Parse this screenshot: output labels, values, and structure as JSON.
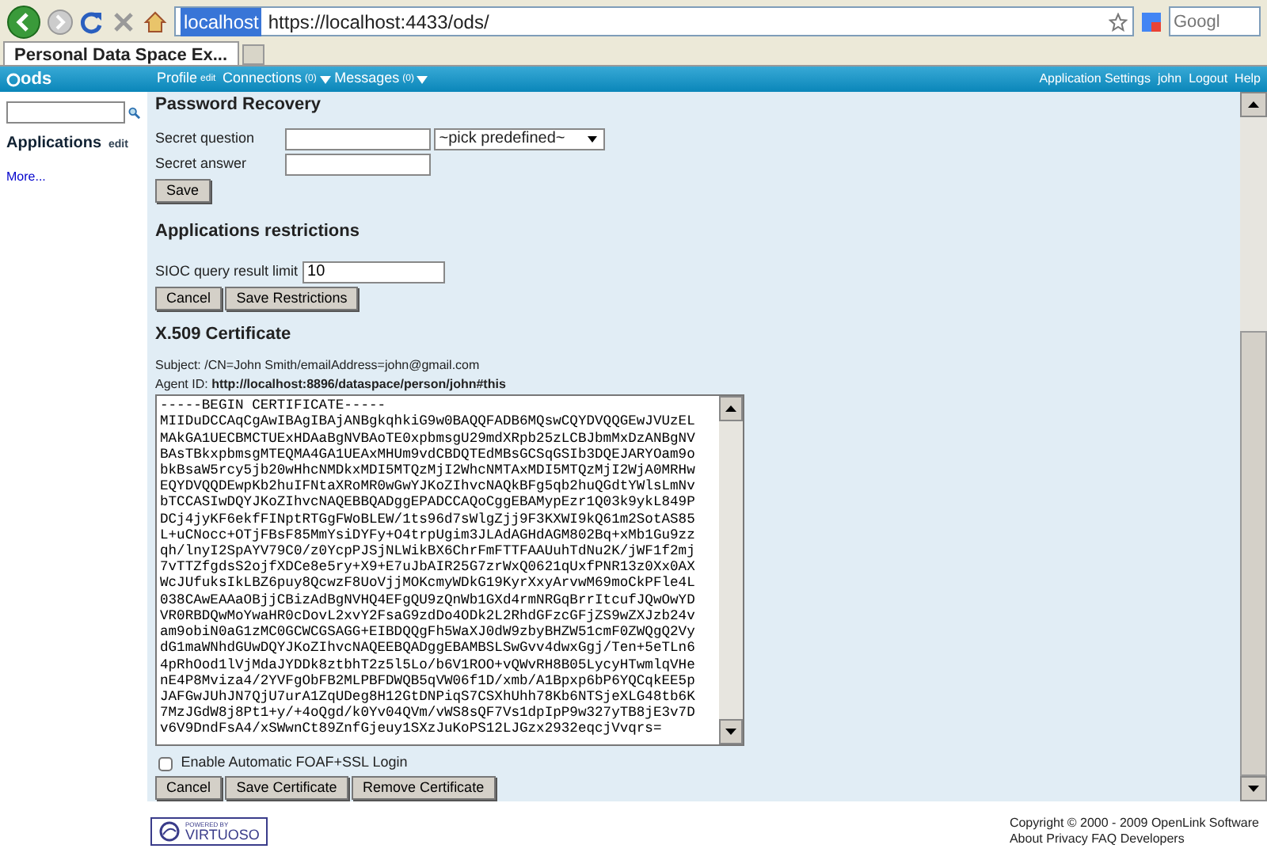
{
  "browser": {
    "address": {
      "site_badge": "localhost",
      "url": "https://localhost:4433/ods/"
    },
    "search": {
      "placeholder": "Googl"
    },
    "tabs": [
      {
        "label": "Personal Data Space Ex...",
        "selected": true
      }
    ]
  },
  "navbar": {
    "logo": "ods",
    "items": [
      {
        "label": "Profile",
        "suffix": "edit",
        "dropdown": false
      },
      {
        "label": "Connections",
        "suffix": "(0)",
        "dropdown": true
      },
      {
        "label": "Messages",
        "suffix": "(0)",
        "dropdown": true
      }
    ],
    "right_links": [
      "Application Settings",
      "john",
      "Logout",
      "Help"
    ]
  },
  "sidebar": {
    "heading": "Applications",
    "edit_link": "edit",
    "more_link": "More..."
  },
  "password_recovery": {
    "title": "Password Recovery",
    "secret_question": {
      "label": "Secret question",
      "select": "~pick predefined~"
    },
    "secret_answer": {
      "label": "Secret answer"
    },
    "buttons": [
      "Save"
    ]
  },
  "applications_restrictions": {
    "title": "Applications restrictions",
    "sioc_limit": {
      "label": "SIOC query result limit",
      "value": "10"
    },
    "buttons": [
      "Cancel",
      "Save Restrictions"
    ]
  },
  "certificate": {
    "title": "X.509 Certificate",
    "subject_label": "Subject:",
    "subject": "/CN=John Smith/emailAddress=john@gmail.com",
    "agent_label": "Agent ID:",
    "agent": "http://localhost:8896/dataspace/person/john#this",
    "text": "-----BEGIN CERTIFICATE-----\nMIIDuDCCAqCgAwIBAgIBAjANBgkqhkiG9w0BAQQFADB6MQswCQYDVQQGEwJVUzEL\nMAkGA1UECBMCTUExHDAaBgNVBAoTE0xpbmsgU29mdXRpb25zLCBJbmMxDzANBgNV\nBAsTBkxpbmsgMTEQMA4GA1UEAxMHUm9vdCBDQTEdMBsGCSqGSIb3DQEJARYOam9o\nbkBsaW5rcy5jb20wHhcNMDkxMDI5MTQzMjI2WhcNMTAxMDI5MTQzMjI2WjA0MRHw\nEQYDVQQDEwpKb2huIFNtaXRoMR0wGwYJKoZIhvcNAQkBFg5qb2huQGdtYWlsLmNv\nbTCCASIwDQYJKoZIhvcNAQEBBQADggEPADCCAQoCggEBAMypEzr1Q03k9ykL849P\nDCj4jyKF6ekfFINptRTGgFWoBLEW/1ts96d7sWlgZjj9F3KXWI9kQ61m2SotAS85\nL+uCNocc+OTjFBsF85MmYsiDYFy+O4trpUgim3JLAdAGHdAGM802Bq+xMb1Gu9zz\nqh/lnyI2SpAYV79C0/z0YcpPJSjNLWikBX6ChrFmFTTFAAUuhTdNu2K/jWF1f2mj\n7vTTZfgdsS2ojfXDCe8e5ry+X9+E7uJbAIR25G7zrWxQ0621qUxfPNR13z0Xx0AX\nWcJUfuksIkLBZ6puy8QcwzF8UoVjjMOKcmyWDkG19KyrXxyArvwM69moCkPFle4L\n038CAwEAAaOBjjCBizAdBgNVHQ4EFgQU9zQnWb1GXd4rmNRGqBrrItcufJQwOwYD\nVR0RBDQwMoYwaHR0cDovL2xvY2FsaG9zdDo4ODk2L2RhdGFzcGFjZS9wZXJzb24v\nam9obiN0aG1zMC0GCWCGSAGG+EIBDQQgFh5WaXJ0dW9zbyBHZW51cmF0ZWQgQ2Vy\ndG1maWNhdGUwDQYJKoZIhvcNAQEEBQADggEBAMBSLSwGvv4dwxGgj/Ten+5eTLn6\n4pRhOod1lVjMdaJYDDk8ztbhT2z5l5Lo/b6V1ROO+vQWvRH8B05LycyHTwmlqVHe\nnE4P8Mviza4/2YVFgObFB2MLPBFDWQB5qVW06f1D/xmb/A1Bpxp6bP6YQCqkEE5p\nJAFGwJUhJN7QjU7urA1ZqUDeg8H12GtDNPiqS7CSXhUhh78Kb6NTSjeXLG48tb6K\n7MzJGdW8j8Pt1+y/+4oQgd/k0Yv04QVm/vWS8sQF7Vs1dpIpP9w327yTB8jE3v7D\nv6V9DndFsA4/xSWwnCt89ZnfGjeuy1SXzJuKoPS12LJGzx2932eqcjVvqrs=",
    "foaf_ssl": {
      "label": "Enable Automatic FOAF+SSL Login",
      "checked": false
    },
    "buttons": [
      "Cancel",
      "Save Certificate",
      "Remove Certificate"
    ]
  },
  "footer": {
    "badge_top": "POWERED BY",
    "badge_name": "VIRTUOSO",
    "copyright": "Copyright © 2000 - 2009 OpenLink Software",
    "links": [
      "About",
      "Privacy",
      "FAQ",
      "Developers"
    ]
  }
}
